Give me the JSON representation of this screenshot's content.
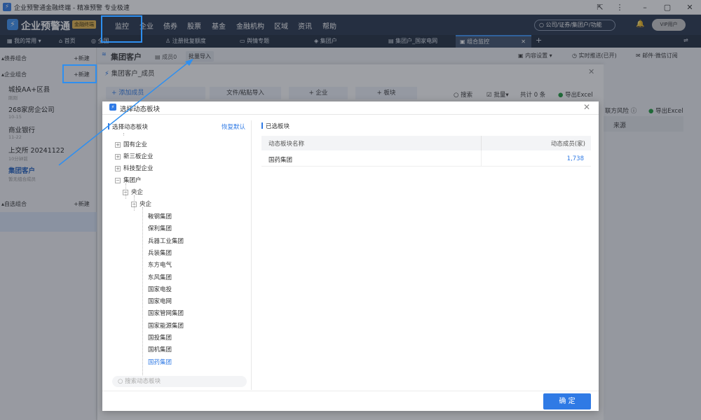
{
  "window": {
    "title": "企业预警通金融终端 - 精准预警 专业极速"
  },
  "topnav": {
    "brand": "企业预警通",
    "badge": "金融终端",
    "items": [
      "监控",
      "企业",
      "债券",
      "股票",
      "基金",
      "金融机构",
      "区域",
      "资讯",
      "帮助"
    ],
    "search_placeholder": "公司/证券/集团户/功能",
    "vip": "VIP用户"
  },
  "tabbar": {
    "menu": "我的常用",
    "home": "首页",
    "global": "全国",
    "tabs": [
      "注册批复额度",
      "舆情专题",
      "集团户",
      "集团户_国家电网"
    ],
    "active_tab": "组合监控"
  },
  "sidebar": {
    "bond_section": "债券组合",
    "enterprise_section": "企业组合",
    "custom_section": "自选组合",
    "new_label": "+新建",
    "items": [
      {
        "name": "城投AA+区县",
        "sub": "刚刚"
      },
      {
        "name": "268家房企公司",
        "sub": "10-15"
      },
      {
        "name": "商业银行",
        "sub": "11-22"
      },
      {
        "name": "上交所 20241122",
        "sub": "10分钟前"
      },
      {
        "name": "集团客户",
        "sub": "暂无组合成员"
      }
    ]
  },
  "pagehead": {
    "title": "集团客户",
    "members": "成员0",
    "batch_import": "批量导入",
    "content_settings": "内容设置",
    "realtime": "实时推送(已开)",
    "mail": "邮件·微信订阅"
  },
  "modal1": {
    "title": "集团客户_成员",
    "add_member": "+ 添加成员",
    "file_import": "文件/粘贴导入",
    "add_enterprise": "+ 企业",
    "add_plate": "+ 板块",
    "search": "搜索",
    "batch": "批量",
    "total": "共计 0 条",
    "export": "导出Excel",
    "col_risk": "联方风险",
    "col_source": "来源",
    "export2": "导出Excel"
  },
  "dialog": {
    "title": "选择动态板块",
    "left_title": "选择动态板块",
    "reset": "恢复默认",
    "tree_top": [
      {
        "label": "国有企业",
        "sign": "+"
      },
      {
        "label": "新三板企业",
        "sign": "+"
      },
      {
        "label": "科技型企业",
        "sign": "+"
      },
      {
        "label": "集团户",
        "sign": "−"
      }
    ],
    "tree_l1": "央企",
    "tree_l2": "央企",
    "tree_leaves": [
      "鞍钢集团",
      "保利集团",
      "兵器工业集团",
      "兵装集团",
      "东方电气",
      "东风集团",
      "国家电投",
      "国家电网",
      "国家管网集团",
      "国家能源集团",
      "国投集团",
      "国机集团",
      "国药集团"
    ],
    "selected_leaf": "国药集团",
    "search_placeholder": "搜索动态板块",
    "right_title": "已选板块",
    "table": {
      "headers": [
        "动态板块名称",
        "动态成员(家)"
      ],
      "rows": [
        [
          "国药集团",
          "1,738"
        ]
      ]
    },
    "ok": "确 定"
  },
  "colors": {
    "accent": "#2f7ae5",
    "nav_bg": "#243249",
    "highlight": "#2e8ff0"
  }
}
